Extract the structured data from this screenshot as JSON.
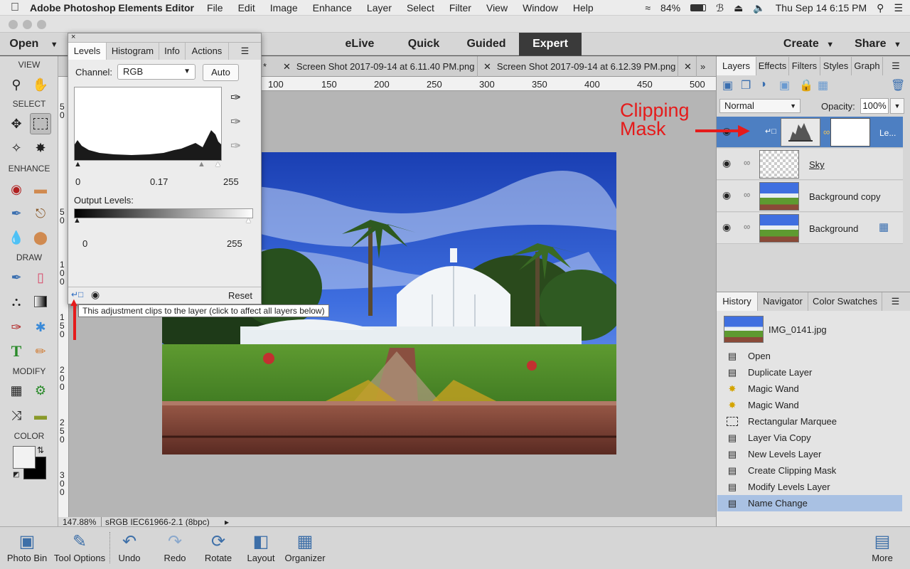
{
  "menubar": {
    "app_name": "Adobe Photoshop Elements Editor",
    "items": [
      "File",
      "Edit",
      "Image",
      "Enhance",
      "Layer",
      "Select",
      "Filter",
      "View",
      "Window",
      "Help"
    ],
    "battery": "84%",
    "datetime": "Thu Sep 14  6:15 PM"
  },
  "modebar": {
    "open_label": "Open",
    "modes": [
      "eLive",
      "Quick",
      "Guided",
      "Expert"
    ],
    "active_mode": "Expert",
    "create_label": "Create",
    "share_label": "Share"
  },
  "toolbar": {
    "sections": [
      "VIEW",
      "SELECT",
      "ENHANCE",
      "DRAW",
      "MODIFY",
      "COLOR"
    ]
  },
  "doc_tabs": [
    "Screen Shot 2017-09-14 at 6.11.40 PM.png",
    "Screen Shot 2017-09-14 at 6.12.39 PM.png"
  ],
  "partial_tab_marker": "*",
  "ruler_top": [
    "100",
    "150",
    "200",
    "250",
    "300",
    "350",
    "400",
    "450",
    "500"
  ],
  "ruler_left": [
    "5 0",
    "5 0",
    "1 0 0",
    "1 5 0",
    "2 0 0",
    "2 5 0",
    "3 0 0"
  ],
  "status": {
    "zoom": "147.88%",
    "profile": "sRGB IEC61966-2.1 (8bpc)"
  },
  "levels_panel": {
    "tabs": [
      "Levels",
      "Histogram",
      "Info",
      "Actions"
    ],
    "active_tab": "Levels",
    "channel_label": "Channel:",
    "channel_value": "RGB",
    "auto_label": "Auto",
    "input_values": [
      "0",
      "0.17",
      "255"
    ],
    "output_label": "Output Levels:",
    "output_values": [
      "0",
      "255"
    ],
    "reset_label": "Reset",
    "tooltip": "This adjustment clips to the layer (click to affect all layers below)"
  },
  "annotation": {
    "clipping_mask_line1": "Clipping",
    "clipping_mask_line2": "Mask",
    "color": "#e51b1b"
  },
  "layers_panel": {
    "tabs": [
      "Layers",
      "Effects",
      "Filters",
      "Styles",
      "Graph"
    ],
    "active_tab": "Layers",
    "blend_mode": "Normal",
    "opacity_label": "Opacity:",
    "opacity_value": "100%",
    "layers": [
      {
        "name": "Le...",
        "selected": true
      },
      {
        "name": "Sky",
        "selected": false
      },
      {
        "name": "Background copy",
        "selected": false
      },
      {
        "name": "Background",
        "selected": false
      }
    ]
  },
  "history_panel": {
    "tabs": [
      "History",
      "Navigator",
      "Color Swatches"
    ],
    "active_tab": "History",
    "snapshot": "IMG_0141.jpg",
    "steps": [
      "Open",
      "Duplicate Layer",
      "Magic Wand",
      "Magic Wand",
      "Rectangular Marquee",
      "Layer Via Copy",
      "New Levels Layer",
      "Create Clipping Mask",
      "Modify Levels Layer",
      "Name Change"
    ],
    "selected_step": "Name Change"
  },
  "bottombar": {
    "buttons": [
      "Photo Bin",
      "Tool Options",
      "Undo",
      "Redo",
      "Rotate",
      "Layout",
      "Organizer"
    ],
    "more_label": "More"
  },
  "colors": {
    "selection_blue": "#4d7fc2",
    "history_selected": "#a9c1e3",
    "mode_active_bg": "#3a3a3a"
  }
}
